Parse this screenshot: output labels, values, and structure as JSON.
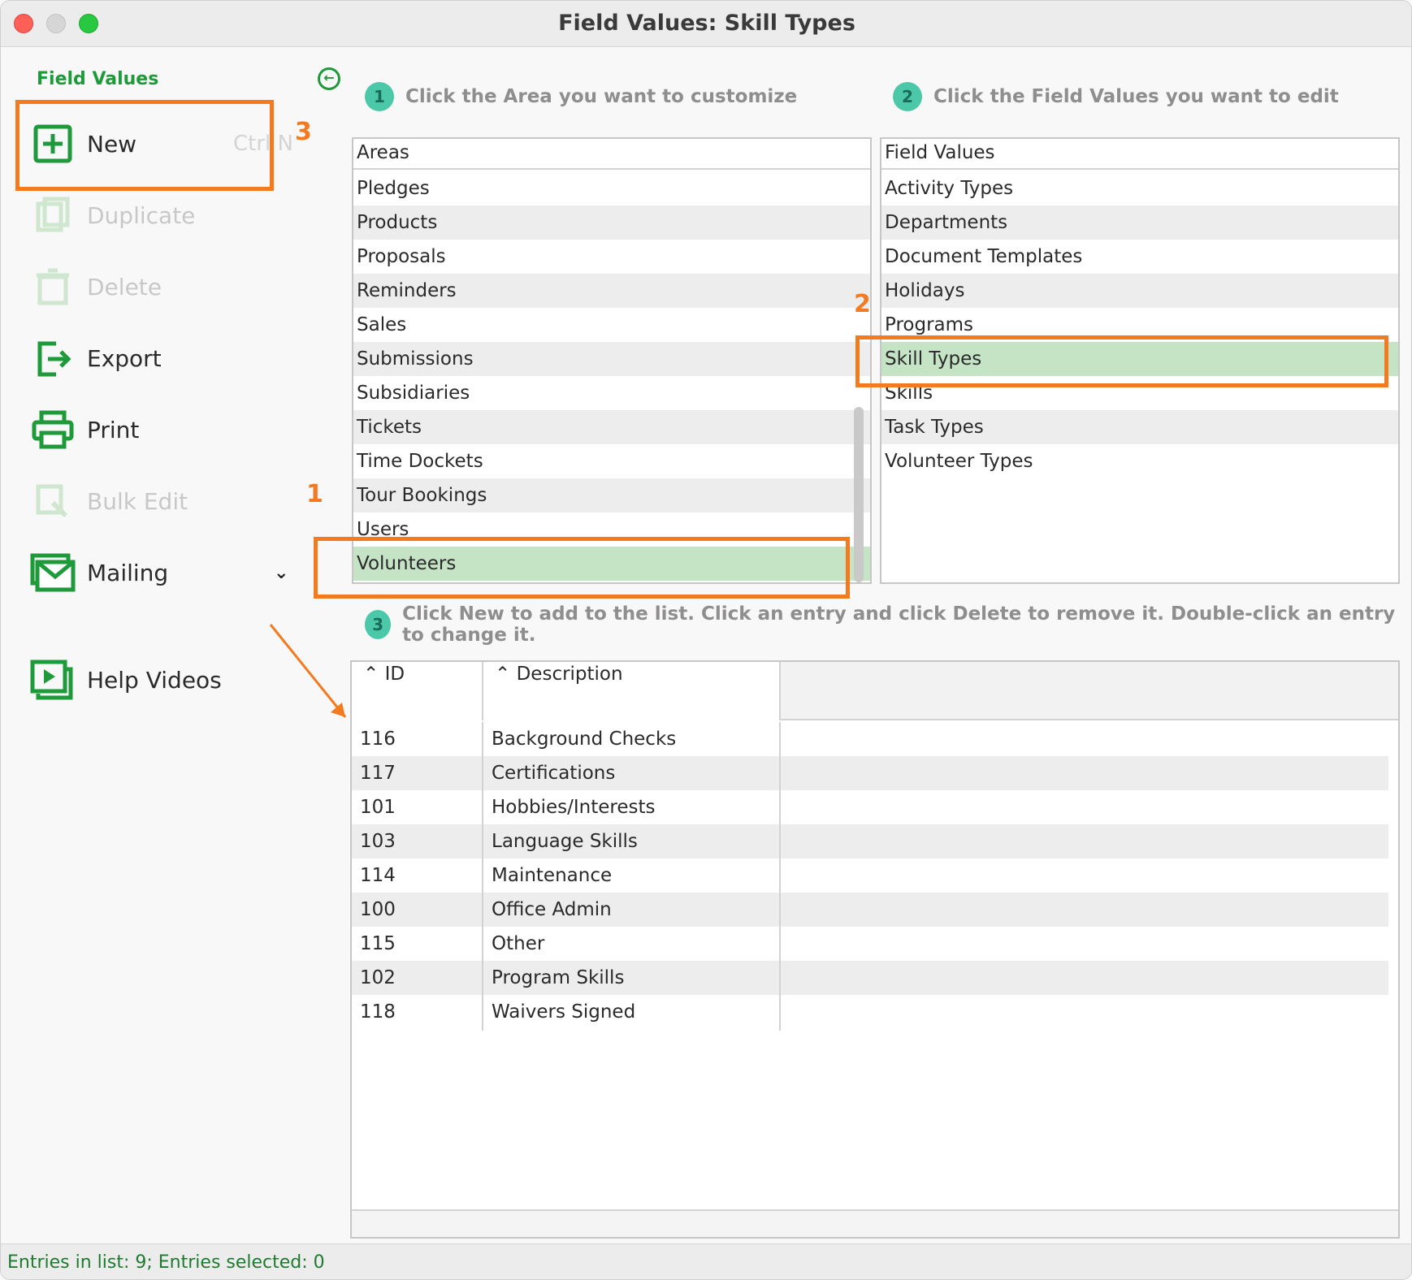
{
  "window": {
    "title": "Field Values: Skill Types"
  },
  "sidebar": {
    "heading": "Field Values",
    "items": [
      {
        "label": "New",
        "shortcut": "Ctrl N",
        "icon": "plus-square-icon",
        "enabled": true
      },
      {
        "label": "Duplicate",
        "icon": "duplicate-icon",
        "enabled": false
      },
      {
        "label": "Delete",
        "icon": "trash-icon",
        "enabled": false
      },
      {
        "label": "Export",
        "icon": "export-icon",
        "enabled": true
      },
      {
        "label": "Print",
        "icon": "printer-icon",
        "enabled": true
      },
      {
        "label": "Bulk Edit",
        "icon": "bulk-edit-icon",
        "enabled": false
      },
      {
        "label": "Mailing",
        "icon": "envelope-icon",
        "enabled": true
      },
      {
        "label": "Help Videos",
        "icon": "video-icon",
        "enabled": true
      }
    ]
  },
  "steps": {
    "s1": {
      "num": "1",
      "text": "Click the Area you want to customize"
    },
    "s2": {
      "num": "2",
      "text": "Click the Field Values you want to edit"
    },
    "s3": {
      "num": "3",
      "text": "Click New to add to the list. Click an entry and click Delete to remove it. Double-click an entry to change it."
    }
  },
  "areas": {
    "header": "Areas",
    "items": [
      "Pledges",
      "Products",
      "Proposals",
      "Reminders",
      "Sales",
      "Submissions",
      "Subsidiaries",
      "Tickets",
      "Time Dockets",
      "Tour Bookings",
      "Users",
      "Volunteers"
    ],
    "selected": "Volunteers"
  },
  "field_values": {
    "header": "Field Values",
    "items": [
      "Activity Types",
      "Departments",
      "Document Templates",
      "Holidays",
      "Programs",
      "Skill Types",
      "Skills",
      "Task Types",
      "Volunteer Types"
    ],
    "selected": "Skill Types"
  },
  "grid": {
    "columns": [
      "ID",
      "Description"
    ],
    "rows": [
      [
        "116",
        "Background Checks"
      ],
      [
        "117",
        "Certifications"
      ],
      [
        "101",
        "Hobbies/Interests"
      ],
      [
        "103",
        "Language Skills"
      ],
      [
        "114",
        "Maintenance"
      ],
      [
        "100",
        "Office Admin"
      ],
      [
        "115",
        "Other"
      ],
      [
        "102",
        "Program Skills"
      ],
      [
        "118",
        "Waivers Signed"
      ]
    ]
  },
  "status": "Entries in list: 9; Entries selected: 0",
  "annotations": [
    "1",
    "2",
    "3"
  ],
  "colors": {
    "accent_green": "#1f9a3a",
    "highlight": "#f47a1f",
    "selection": "#c5e4c5"
  }
}
